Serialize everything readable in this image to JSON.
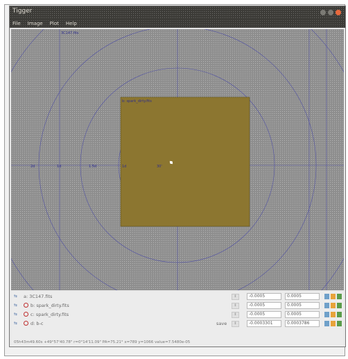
{
  "window": {
    "title": "Tigger",
    "close_color": "#e9693d"
  },
  "menu": [
    "File",
    "Image",
    "Plot",
    "Help"
  ],
  "canvas": {
    "background": "#8e8e8e",
    "image_fill": "#8c7630",
    "grid_color": "#3a3aa8",
    "labels": {
      "source_top": "3C147.fits",
      "source_box": "b: spark_dirty.fits",
      "ax1": "2d",
      "ax2": "1d",
      "ax3": "1.5d",
      "ax4": "1d",
      "ax5": "30'"
    }
  },
  "layers": [
    {
      "name": "a: 3C147.fits",
      "has_close": false,
      "save": "",
      "min": "-0.0005",
      "max": "0.0005"
    },
    {
      "name": "b: spark_dirty.fits",
      "has_close": true,
      "save": "",
      "min": "-0.0005",
      "max": "0.0005"
    },
    {
      "name": "c: spark_dirty.fits",
      "has_close": true,
      "save": "",
      "min": "-0.0005",
      "max": "0.0005"
    },
    {
      "name": "d: b-c",
      "has_close": true,
      "save": "save",
      "min": "-0.0003301",
      "max": "0.0003786"
    }
  ],
  "status": "05h43m49.60s +49°57'40.78\" r=0°14'11.09\" PA=75.21°  x=789 y=1066 value=7.5480e-05"
}
